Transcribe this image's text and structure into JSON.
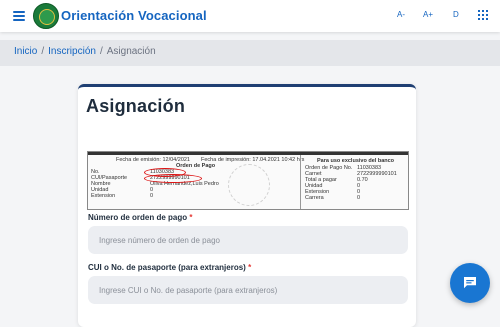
{
  "header": {
    "brand": "Orientación Vocacional",
    "font_controls": [
      "A-",
      "A+",
      "D"
    ]
  },
  "breadcrumb": {
    "items": [
      "Inicio",
      "Inscripción"
    ],
    "current": "Asignación"
  },
  "card": {
    "title": "Asignación"
  },
  "receipt": {
    "emission_date": "Fecha de emisión: 12/04/2021",
    "print_date": "Fecha de impresión: 17.04.2021 10:42 hrs",
    "heading": "Orden de Pago",
    "rows": [
      {
        "label": "No.",
        "value": "11030383"
      },
      {
        "label": "CUI/Pasaporte",
        "value": "2722999990101"
      },
      {
        "label": "Nombre",
        "value": "Oliva Hernandez,Luis Pedro"
      },
      {
        "label": "Unidad",
        "value": "0"
      },
      {
        "label": "Extension",
        "value": "0"
      }
    ],
    "bank_heading": "Para uso exclusivo del banco",
    "bank_rows": [
      {
        "label": "Orden de Pago No.",
        "value": "11030383"
      },
      {
        "label": "Carnet",
        "value": "2722999990101"
      },
      {
        "label": "Total a pagar",
        "value": "0.70"
      },
      {
        "label": "Unidad",
        "value": "0"
      },
      {
        "label": "Extension",
        "value": "0"
      },
      {
        "label": "Carrera",
        "value": "0"
      }
    ]
  },
  "form": {
    "order_label": "Número de orden de pago",
    "order_placeholder": "Ingrese número de orden de pago",
    "cui_label": "CUI o No. de pasaporte (para extranjeros)",
    "cui_placeholder": "Ingrese CUI o No. de pasaporte (para extranjeros)",
    "required_mark": "*"
  },
  "colors": {
    "primary": "#1565c0",
    "card_accent": "#1f3f73",
    "required": "#e53935",
    "chat": "#1976d2"
  },
  "icons": {
    "menu": "hamburger-icon",
    "logo": "university-seal-logo",
    "apps": "grid-icon",
    "chat": "chat-bubble-icon"
  }
}
